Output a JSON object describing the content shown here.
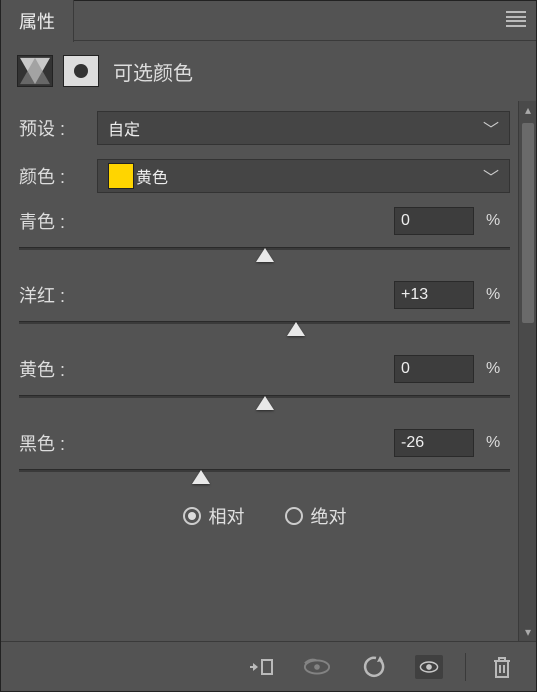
{
  "header": {
    "tab": "属性"
  },
  "adjustment": {
    "title": "可选颜色"
  },
  "preset": {
    "label": "预设 :",
    "value": "自定"
  },
  "color": {
    "label": "颜色 :",
    "value": "黄色",
    "swatch": "#ffd500"
  },
  "sliders": {
    "cyan": {
      "label": "青色 :",
      "value": "0",
      "percent": 50
    },
    "magenta": {
      "label": "洋红 :",
      "value": "+13",
      "percent": 56.5
    },
    "yellow": {
      "label": "黄色 :",
      "value": "0",
      "percent": 50
    },
    "black": {
      "label": "黑色 :",
      "value": "-26",
      "percent": 37
    }
  },
  "unit": "%",
  "method": {
    "relative": "相对",
    "absolute": "绝对",
    "selected": "relative"
  },
  "icons": {
    "clip": "clip-to-layer-icon",
    "view_prev": "view-previous-icon",
    "reset": "reset-icon",
    "visibility": "visibility-icon",
    "trash": "trash-icon"
  }
}
